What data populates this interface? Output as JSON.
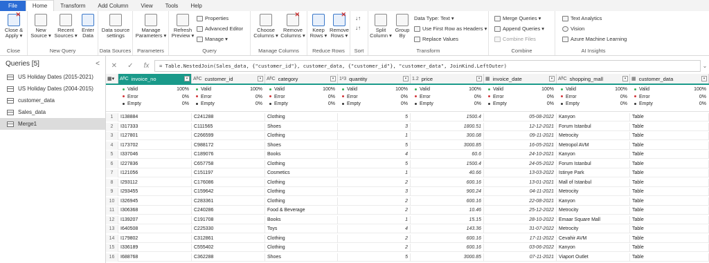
{
  "tabs": [
    "File",
    "Home",
    "Transform",
    "Add Column",
    "View",
    "Tools",
    "Help"
  ],
  "ribbon": {
    "close": {
      "btn": "Close & Apply ▾",
      "label": "Close"
    },
    "newquery": {
      "new": "New Source ▾",
      "recent": "Recent Sources ▾",
      "enter": "Enter Data",
      "label": "New Query"
    },
    "datasources": {
      "btn": "Data source settings",
      "label": "Data Sources"
    },
    "parameters": {
      "btn": "Manage Parameters ▾",
      "label": "Parameters"
    },
    "query": {
      "refresh": "Refresh Preview ▾",
      "properties": "Properties",
      "advanced": "Advanced Editor",
      "manage": "Manage ▾",
      "label": "Query"
    },
    "managecols": {
      "choose": "Choose Columns ▾",
      "remove": "Remove Columns ▾",
      "label": "Manage Columns"
    },
    "reducerows": {
      "keep": "Keep Rows ▾",
      "remove": "Remove Rows ▾",
      "label": "Reduce Rows"
    },
    "sort": {
      "label": "Sort"
    },
    "transform": {
      "split": "Split Column ▾",
      "group": "Group By",
      "datatype": "Data Type: Text ▾",
      "firstrow": "Use First Row as Headers ▾",
      "replace": "Replace Values",
      "label": "Transform"
    },
    "combine": {
      "merge": "Merge Queries ▾",
      "append": "Append Queries ▾",
      "files": "Combine Files",
      "label": "Combine"
    },
    "ai": {
      "text": "Text Analytics",
      "vision": "Vision",
      "ml": "Azure Machine Learning",
      "label": "AI Insights"
    }
  },
  "queries": {
    "title": "Queries [5]",
    "collapse": "<",
    "items": [
      {
        "label": "US Holiday Dates (2015-2021)",
        "selected": false
      },
      {
        "label": "US Holiday Dates (2004-2015)",
        "selected": false
      },
      {
        "label": "customer_data",
        "selected": false
      },
      {
        "label": "Sales_data",
        "selected": false
      },
      {
        "label": "Merge1",
        "selected": true
      }
    ]
  },
  "formula": {
    "cancel": "✕",
    "confirm": "✓",
    "fx": "fx",
    "text": "= Table.NestedJoin(Sales_data, {\"customer_id\"}, customer_data, {\"customer_id\"}, \"customer_data\", JoinKind.LeftOuter)",
    "expand": "⌄"
  },
  "table": {
    "corner": "▦▾",
    "columns": [
      {
        "name": "invoice_no",
        "type": "AᴮC"
      },
      {
        "name": "customer_id",
        "type": "AᴮC"
      },
      {
        "name": "category",
        "type": "AᴮC"
      },
      {
        "name": "quantity",
        "type": "1²3"
      },
      {
        "name": "price",
        "type": "1.2"
      },
      {
        "name": "invoice_date",
        "type": "▦"
      },
      {
        "name": "shopping_mall",
        "type": "AᴮC"
      },
      {
        "name": "customer_data",
        "type": "▦"
      }
    ],
    "quality": {
      "labels": [
        "Valid",
        "Error",
        "Empty"
      ],
      "values": [
        "100%",
        "0%",
        "0%"
      ],
      "colors": [
        "#3fae5a",
        "#d13438",
        "#333333"
      ]
    },
    "rows": [
      [
        "1",
        "I138884",
        "C241288",
        "Clothing",
        "5",
        "1500.4",
        "05-08-2022",
        "Kanyon",
        "Table"
      ],
      [
        "2",
        "I317333",
        "C111565",
        "Shoes",
        "3",
        "1800.51",
        "12-12-2021",
        "Forum Istanbul",
        "Table"
      ],
      [
        "3",
        "I127801",
        "C266599",
        "Clothing",
        "1",
        "300.08",
        "09-11-2021",
        "Metrocity",
        "Table"
      ],
      [
        "4",
        "I173702",
        "C988172",
        "Shoes",
        "5",
        "3000.85",
        "16-05-2021",
        "Metropol AVM",
        "Table"
      ],
      [
        "5",
        "I337046",
        "C189076",
        "Books",
        "4",
        "60.6",
        "24-10-2021",
        "Kanyon",
        "Table"
      ],
      [
        "6",
        "I227836",
        "C657758",
        "Clothing",
        "5",
        "1500.4",
        "24-05-2022",
        "Forum Istanbul",
        "Table"
      ],
      [
        "7",
        "I121056",
        "C151197",
        "Cosmetics",
        "1",
        "40.66",
        "13-03-2022",
        "Istinye Park",
        "Table"
      ],
      [
        "8",
        "I293112",
        "C176086",
        "Clothing",
        "2",
        "600.16",
        "13-01-2021",
        "Mall of Istanbul",
        "Table"
      ],
      [
        "9",
        "I293455",
        "C159642",
        "Clothing",
        "3",
        "900.24",
        "04-11-2021",
        "Metrocity",
        "Table"
      ],
      [
        "10",
        "I326945",
        "C283361",
        "Clothing",
        "2",
        "600.16",
        "22-08-2021",
        "Kanyon",
        "Table"
      ],
      [
        "11",
        "I306368",
        "C240286",
        "Food & Beverage",
        "2",
        "10.46",
        "25-12-2022",
        "Metrocity",
        "Table"
      ],
      [
        "12",
        "I139207",
        "C191708",
        "Books",
        "1",
        "15.15",
        "28-10-2022",
        "Emaar Square Mall",
        "Table"
      ],
      [
        "13",
        "I640508",
        "C225330",
        "Toys",
        "4",
        "143.36",
        "31-07-2022",
        "Metrocity",
        "Table"
      ],
      [
        "14",
        "I179802",
        "C312861",
        "Clothing",
        "2",
        "600.16",
        "17-11-2022",
        "Cevahir AVM",
        "Table"
      ],
      [
        "15",
        "I336189",
        "C555402",
        "Clothing",
        "2",
        "600.16",
        "03-06-2022",
        "Kanyon",
        "Table"
      ],
      [
        "16",
        "I688768",
        "C362288",
        "Shoes",
        "5",
        "3000.85",
        "07-11-2021",
        "Viaport Outlet",
        "Table"
      ]
    ]
  }
}
